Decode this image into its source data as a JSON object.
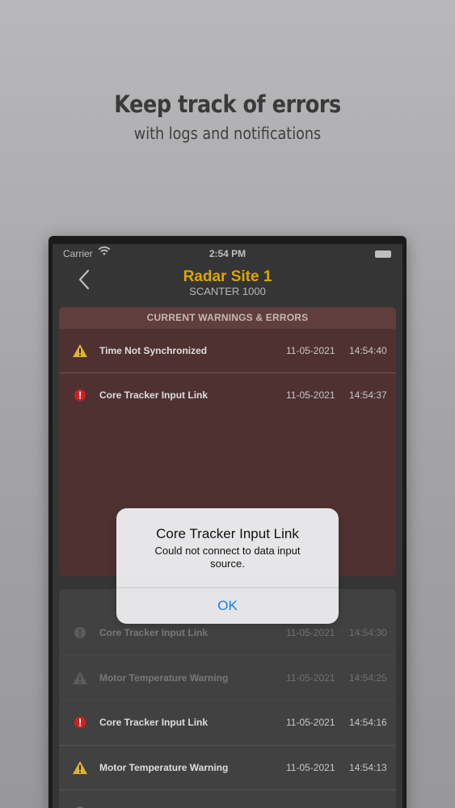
{
  "promo": {
    "title": "Keep track of errors",
    "subtitle": "with logs and notifications"
  },
  "status_bar": {
    "carrier": "Carrier",
    "time": "2:54 PM"
  },
  "nav": {
    "title": "Radar Site 1",
    "subtitle": "SCANTER 1000"
  },
  "current_panel": {
    "header": "CURRENT WARNINGS & ERRORS",
    "rows": [
      {
        "icon": "warning-icon",
        "name": "Time Not Synchronized",
        "date": "11-05-2021",
        "time": "14:54:40"
      },
      {
        "icon": "error-icon",
        "name": "Core Tracker Input Link",
        "date": "11-05-2021",
        "time": "14:54:37"
      }
    ]
  },
  "log_panel": {
    "rows": [
      {
        "icon": "error-icon",
        "name": "Core Tracker Input Link",
        "date": "11-05-2021",
        "time": "14:54:30"
      },
      {
        "icon": "warning-icon",
        "name": "Motor Temperature Warning",
        "date": "11-05-2021",
        "time": "14:54:25"
      },
      {
        "icon": "error-icon",
        "name": "Core Tracker Input Link",
        "date": "11-05-2021",
        "time": "14:54:16"
      },
      {
        "icon": "warning-icon",
        "name": "Motor Temperature Warning",
        "date": "11-05-2021",
        "time": "14:54:13"
      }
    ]
  },
  "alert": {
    "title": "Core Tracker Input Link",
    "message": "Could not connect to data input source.",
    "ok_label": "OK"
  },
  "colors": {
    "accent_title": "#f0b400",
    "warning": "#f0c23a",
    "error": "#e02424",
    "link": "#1a7cf5"
  }
}
